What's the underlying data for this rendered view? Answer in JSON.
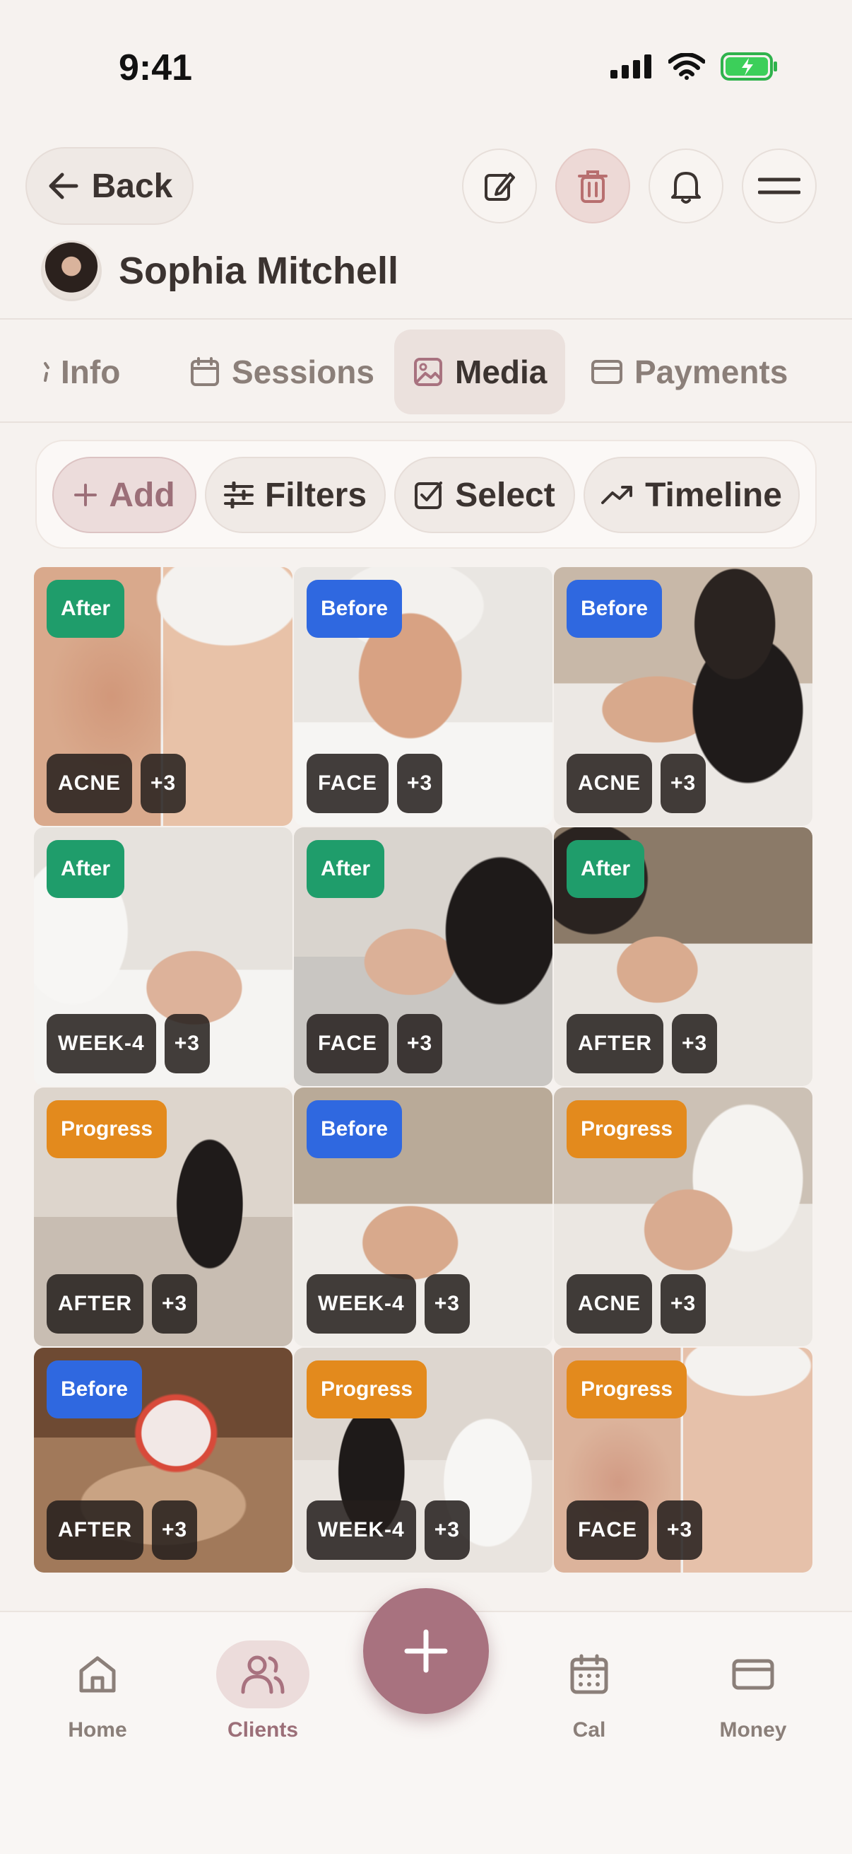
{
  "status_bar": {
    "time": "9:41"
  },
  "header": {
    "back_label": "Back",
    "actions": [
      "edit-icon",
      "trash-icon",
      "bell-icon",
      "menu-icon"
    ]
  },
  "client": {
    "name": "Sophia Mitchell"
  },
  "tabs": [
    {
      "label": "Info",
      "icon": "info-icon"
    },
    {
      "label": "Sessions",
      "icon": "calendar-icon"
    },
    {
      "label": "Media",
      "icon": "image-icon",
      "active": true
    },
    {
      "label": "Payments",
      "icon": "card-icon"
    }
  ],
  "toolbar": {
    "add": "Add",
    "filters": "Filters",
    "select": "Select",
    "timeline": "Timeline"
  },
  "colors": {
    "after": "#1f9d6b",
    "before": "#2f68e0",
    "progress": "#e38a1d",
    "accent": "#a8727f"
  },
  "media": [
    {
      "stage": "After",
      "tag": "ACNE",
      "more": "+3"
    },
    {
      "stage": "Before",
      "tag": "FACE",
      "more": "+3"
    },
    {
      "stage": "Before",
      "tag": "ACNE",
      "more": "+3"
    },
    {
      "stage": "After",
      "tag": "WEEK-4",
      "more": "+3"
    },
    {
      "stage": "After",
      "tag": "FACE",
      "more": "+3"
    },
    {
      "stage": "After",
      "tag": "AFTER",
      "more": "+3"
    },
    {
      "stage": "Progress",
      "tag": "AFTER",
      "more": "+3"
    },
    {
      "stage": "Before",
      "tag": "WEEK-4",
      "more": "+3"
    },
    {
      "stage": "Progress",
      "tag": "ACNE",
      "more": "+3"
    },
    {
      "stage": "Before",
      "tag": "AFTER",
      "more": "+3"
    },
    {
      "stage": "Progress",
      "tag": "WEEK-4",
      "more": "+3"
    },
    {
      "stage": "Progress",
      "tag": "FACE",
      "more": "+3"
    }
  ],
  "bottom_nav": [
    {
      "label": "Home",
      "icon": "home-icon"
    },
    {
      "label": "Clients",
      "icon": "users-icon",
      "active": true
    },
    {
      "label": "Cal",
      "icon": "calendar-icon"
    },
    {
      "label": "Money",
      "icon": "card-icon"
    }
  ]
}
